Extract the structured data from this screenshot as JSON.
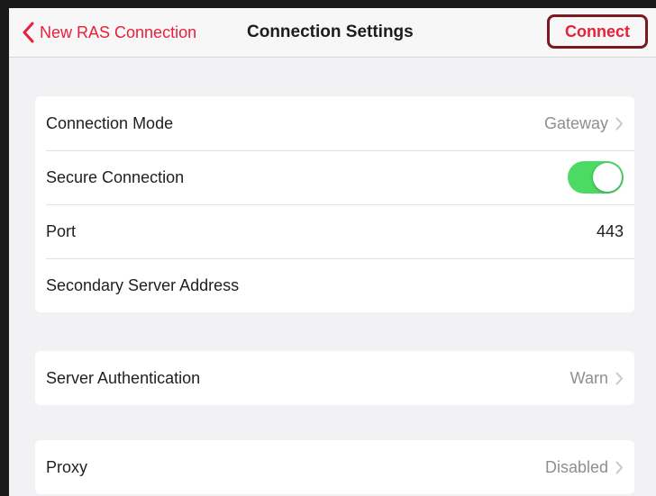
{
  "navbar": {
    "back_label": "New RAS Connection",
    "title": "Connection Settings",
    "connect_label": "Connect"
  },
  "section1": {
    "rows": [
      {
        "title": "Connection Mode",
        "value": "Gateway"
      },
      {
        "title": "Secure Connection",
        "toggle_on": true
      },
      {
        "title": "Port",
        "value": "443"
      },
      {
        "title": "Secondary Server Address",
        "value": ""
      }
    ]
  },
  "section2": {
    "rows": [
      {
        "title": "Server Authentication",
        "value": "Warn"
      }
    ]
  },
  "section3": {
    "rows": [
      {
        "title": "Proxy",
        "value": "Disabled"
      }
    ]
  },
  "colors": {
    "accent": "#e8203a",
    "toggle_on": "#4cd964",
    "highlight_border": "#7a1a20"
  }
}
